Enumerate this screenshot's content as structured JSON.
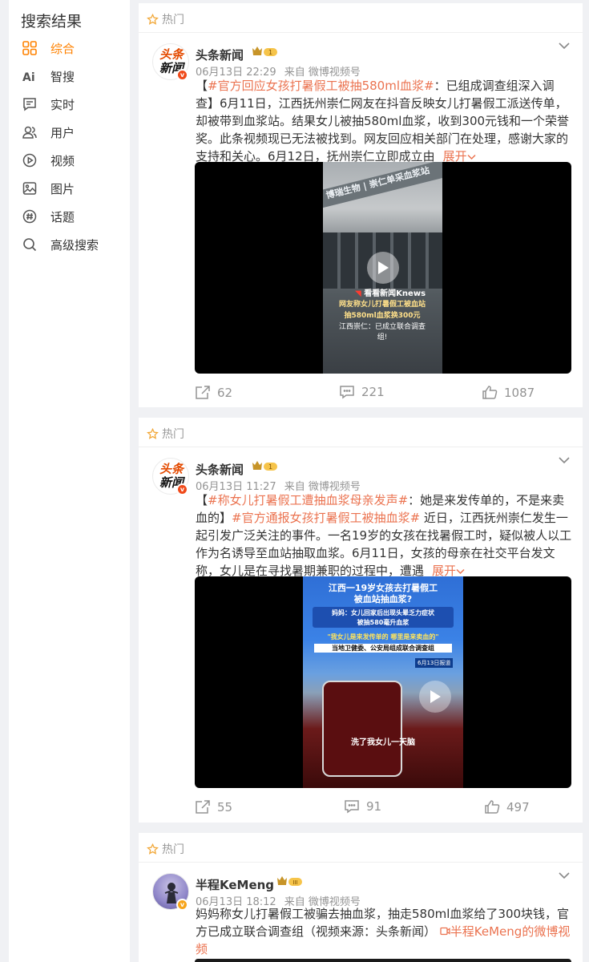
{
  "sidebar": {
    "title": "搜索结果",
    "items": [
      {
        "label": "综合",
        "icon": "grid-icon",
        "active": true
      },
      {
        "label": "智搜",
        "icon": "ai-icon"
      },
      {
        "label": "实时",
        "icon": "realtime-icon"
      },
      {
        "label": "用户",
        "icon": "user-icon"
      },
      {
        "label": "视频",
        "icon": "video-play-icon"
      },
      {
        "label": "图片",
        "icon": "image-icon"
      },
      {
        "label": "话题",
        "icon": "topic-hash-icon"
      },
      {
        "label": "高级搜索",
        "icon": "search-icon"
      }
    ]
  },
  "accent_color": "#ff8200",
  "topic_color": "#eb7350",
  "posts": [
    {
      "hot_label": "热门",
      "user": {
        "name": "头条新闻",
        "avatar_line1": "头条",
        "avatar_line2": "新闻",
        "vip_level": "1"
      },
      "date": "06月13日 22:29",
      "source": "来自 微博视频号",
      "topic1": "#官方回应女孩打暑假工被抽580ml血浆#",
      "body": "：已组成调查组深入调查】6月11日，江西抚州崇仁网友在抖音反映女儿打暑假工派送传单，却被带到血浆站。结果女儿被抽580ml血浆，收到300元钱和一个荣誉奖。此条视频现已无法被找到。网友回应相关部门在处理，感谢大家的支持和关心。6月12日，抚州崇仁立即成立由",
      "expand": "展开",
      "video": {
        "sign1": "博瑞生物",
        "sign2": "崇仁单采血浆站",
        "brand": "看看新闻Knews",
        "caption1": "网友称女儿打暑假工被血站",
        "caption2": "抽580ml血浆换300元",
        "caption3": "江西崇仁：已成立联合调查组!"
      },
      "repost_count": "62",
      "comment_count": "221",
      "like_count": "1087"
    },
    {
      "hot_label": "热门",
      "user": {
        "name": "头条新闻",
        "avatar_line1": "头条",
        "avatar_line2": "新闻",
        "vip_level": "1"
      },
      "date": "06月13日 11:27",
      "source": "来自 微博视频号",
      "topic1": "#称女儿打暑假工遭抽血浆母亲发声#",
      "mid": "：她是来发传单的，不是来卖血的】",
      "topic2": "#官方通报女孩打暑假工被抽血浆#",
      "body": " 近日，江西抚州崇仁发生一起引发广泛关注的事件。一名19岁的女孩在找暑假工时，疑似被人以工作为名诱导至血站抽取血浆。6月11日，女孩的母亲在社交平台发文称，女儿是在寻找暑期兼职的过程中，遭遇",
      "expand": "展开",
      "video": {
        "title1": "江西一19岁女孩去打暑假工",
        "title2": "被血站抽血浆?",
        "sub1": "妈妈：女儿回家后出现头晕乏力症状",
        "sub2": "被抽580毫升血浆",
        "quote": "\"我女儿是来发传单的 哪里是来卖血的\"",
        "sub3": "当地卫健委、公安局组成联合调查组",
        "date_tag": "6月13日报道",
        "bottom": "洗了我女儿一天脑"
      },
      "repost_count": "55",
      "comment_count": "91",
      "like_count": "497"
    },
    {
      "hot_label": "热门",
      "user": {
        "name": "半程KeMeng",
        "vip_level": "III"
      },
      "date": "06月13日 18:12",
      "source": "来自 微博视频号",
      "body": "妈妈称女儿打暑假工被骗去抽血浆，抽走580ml血浆给了300块钱，官方已成立联合调查组（视频来源：头条新闻）",
      "link": "半程KeMeng的微博视频"
    }
  ]
}
